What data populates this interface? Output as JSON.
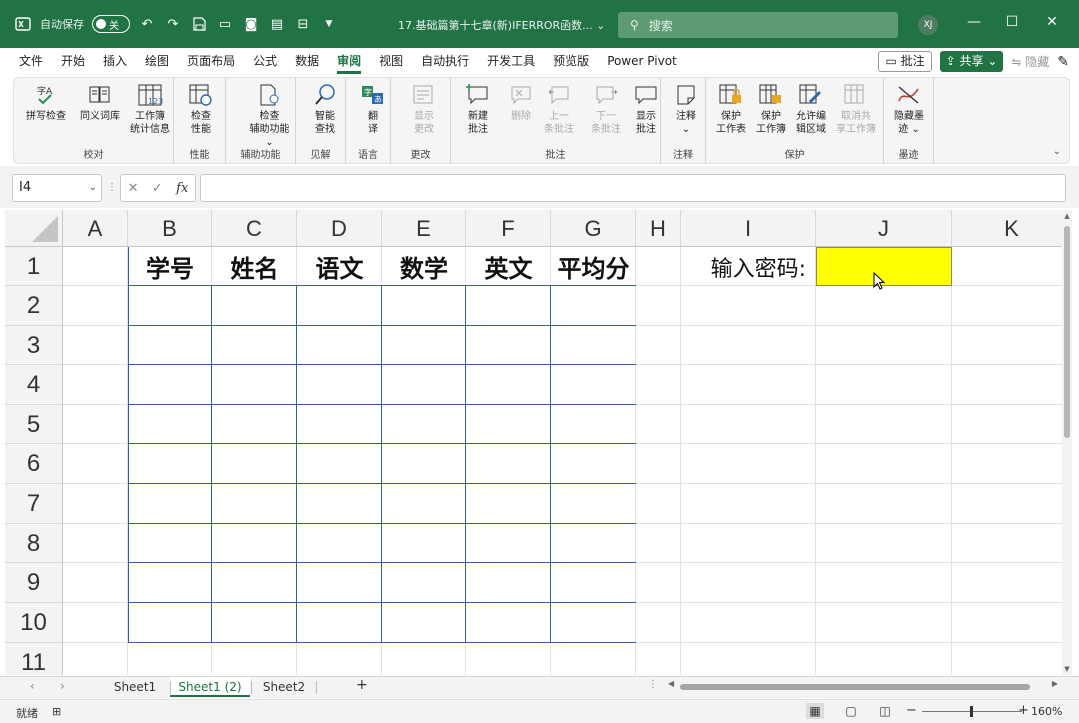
{
  "titlebar": {
    "autosave_label": "自动保存",
    "autosave_state": "关",
    "doc_title": "17.基础篇第十七章(新)IFERROR函数... ⌄",
    "search_placeholder": "搜索",
    "user_initials": "XJ"
  },
  "menu": {
    "tabs": [
      "文件",
      "开始",
      "插入",
      "绘图",
      "页面布局",
      "公式",
      "数据",
      "审阅",
      "视图",
      "自动执行",
      "开发工具",
      "预览版",
      "Power Pivot"
    ],
    "active_tab": "审阅",
    "comment_button": "批注",
    "share_button": "共享",
    "hide_button": "隐藏"
  },
  "ribbon": {
    "groups": [
      {
        "label": "校对",
        "buttons": [
          "拼写检查",
          "同义词库",
          "工作簿\n统计信息"
        ]
      },
      {
        "label": "性能",
        "buttons": [
          "检查\n性能"
        ]
      },
      {
        "label": "辅助功能",
        "buttons": [
          "检查\n辅助功能 ⌄"
        ]
      },
      {
        "label": "见解",
        "buttons": [
          "智能\n查找"
        ]
      },
      {
        "label": "语言",
        "buttons": [
          "翻\n译"
        ]
      },
      {
        "label": "更改",
        "buttons": [
          "显示\n更改"
        ]
      },
      {
        "label": "批注",
        "buttons": [
          "新建\n批注",
          "删除",
          "上一\n条批注",
          "下一\n条批注",
          "显示\n批注"
        ]
      },
      {
        "label": "注释",
        "buttons": [
          "注释\n⌄"
        ]
      },
      {
        "label": "保护",
        "buttons": [
          "保护\n工作表",
          "保护\n工作簿",
          "允许编\n辑区域",
          "取消共\n享工作簿"
        ]
      },
      {
        "label": "墨迹",
        "buttons": [
          "隐藏墨\n迹 ⌄"
        ]
      }
    ]
  },
  "formula_bar": {
    "name_box": "I4",
    "fx_label": "fx",
    "formula": ""
  },
  "grid": {
    "columns": [
      "A",
      "B",
      "C",
      "D",
      "E",
      "F",
      "G",
      "H",
      "I",
      "J",
      "K"
    ],
    "rows": [
      "1",
      "2",
      "3",
      "4",
      "5",
      "6",
      "7",
      "8",
      "9",
      "10",
      "11"
    ],
    "table_headers": [
      "学号",
      "姓名",
      "语文",
      "数学",
      "英文",
      "平均分"
    ],
    "password_label": "输入密码:",
    "password_value": ""
  },
  "sheets": {
    "tabs": [
      "Sheet1",
      "Sheet1 (2)",
      "Sheet2"
    ],
    "active": "Sheet1 (2)",
    "add_label": "+"
  },
  "status": {
    "ready": "就绪",
    "zoom": "160%"
  },
  "colors": {
    "brand": "#217346",
    "password_fill": "#ffff00",
    "table_border": "#3b5ba5"
  }
}
